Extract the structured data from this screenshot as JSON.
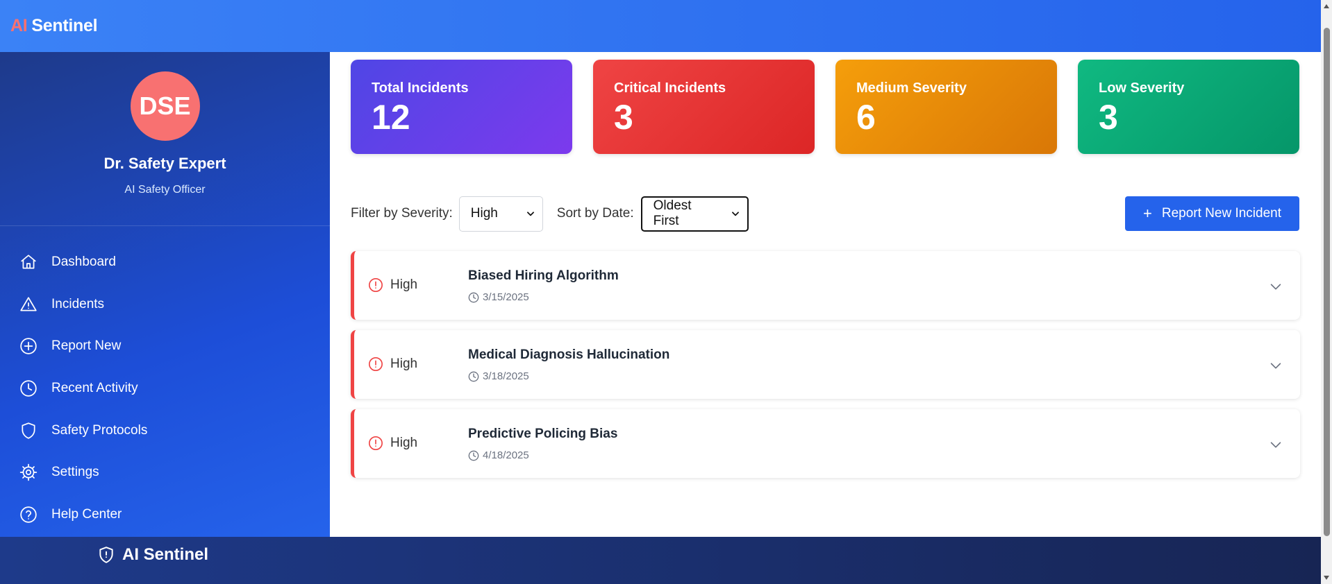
{
  "app": {
    "brand_ai": "AI",
    "brand_name": "Sentinel"
  },
  "profile": {
    "initials": "DSE",
    "name": "Dr. Safety Expert",
    "role": "AI Safety Officer"
  },
  "sidebar": {
    "items": [
      {
        "label": "Dashboard",
        "icon": "home-icon"
      },
      {
        "label": "Incidents",
        "icon": "warning-icon"
      },
      {
        "label": "Report New",
        "icon": "plus-circle-icon"
      },
      {
        "label": "Recent Activity",
        "icon": "clock-icon"
      },
      {
        "label": "Safety Protocols",
        "icon": "shield-icon"
      },
      {
        "label": "Settings",
        "icon": "gear-icon"
      },
      {
        "label": "Help Center",
        "icon": "help-circle-icon"
      }
    ]
  },
  "stats": [
    {
      "label": "Total Incidents",
      "value": "12",
      "color": "#6d3eea"
    },
    {
      "label": "Critical Incidents",
      "value": "3",
      "color": "#e53535"
    },
    {
      "label": "Medium Severity",
      "value": "6",
      "color": "#e68a08"
    },
    {
      "label": "Low Severity",
      "value": "3",
      "color": "#0ea772"
    }
  ],
  "filters": {
    "severity_label": "Filter by Severity:",
    "severity_value": "High",
    "sort_label": "Sort by Date:",
    "sort_value": "Oldest First",
    "report_button": "Report New Incident"
  },
  "incidents": [
    {
      "severity": "High",
      "title": "Biased Hiring Algorithm",
      "date": "3/15/2025"
    },
    {
      "severity": "High",
      "title": "Medical Diagnosis Hallucination",
      "date": "3/18/2025"
    },
    {
      "severity": "High",
      "title": "Predictive Policing Bias",
      "date": "4/18/2025"
    }
  ],
  "footer": {
    "brand": "AI Sentinel"
  },
  "colors": {
    "accent": "#2563eb",
    "high_severity": "#ef4444"
  }
}
